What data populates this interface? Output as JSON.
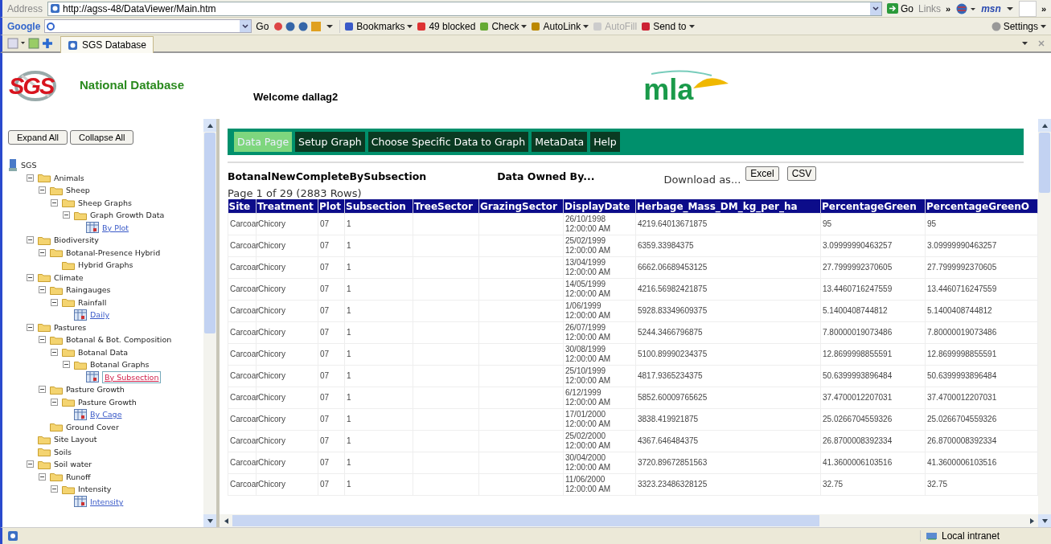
{
  "browser": {
    "address_label": "Address",
    "url": "http://agss-48/DataViewer/Main.htm",
    "go": "Go",
    "links": "Links",
    "links_more": "»",
    "msn": "msn",
    "more": "»",
    "google_label": "Google",
    "google_go": "Go",
    "toolbar_items": [
      {
        "label": "Bookmarks",
        "caret": true,
        "disabled": false
      },
      {
        "label": "49 blocked",
        "caret": false,
        "disabled": false
      },
      {
        "label": "Check",
        "caret": true,
        "disabled": false
      },
      {
        "label": "AutoLink",
        "caret": true,
        "disabled": false
      },
      {
        "label": "AutoFill",
        "caret": false,
        "disabled": true
      },
      {
        "label": "Send to",
        "caret": true,
        "disabled": false
      }
    ],
    "settings": "Settings",
    "tab": "SGS Database"
  },
  "header": {
    "logo": "SGS",
    "title": "National Database",
    "welcome": "Welcome dallag2",
    "partner_logo": "mla"
  },
  "sidebar": {
    "buttons": [
      "Expand All",
      "Collapse All"
    ],
    "tree": [
      {
        "label": "SGS",
        "kind": "root",
        "children": [
          {
            "label": "Animals",
            "kind": "folder",
            "expanded": true,
            "children": [
              {
                "label": "Sheep",
                "kind": "folder",
                "expanded": true,
                "children": [
                  {
                    "label": "Sheep Graphs",
                    "kind": "folder",
                    "expanded": true,
                    "children": [
                      {
                        "label": "Graph Growth Data",
                        "kind": "folder",
                        "expanded": true,
                        "children": [
                          {
                            "label": "By Plot",
                            "kind": "report",
                            "selected": false
                          }
                        ]
                      }
                    ]
                  }
                ]
              }
            ]
          },
          {
            "label": "Biodiversity",
            "kind": "folder",
            "expanded": true,
            "children": [
              {
                "label": "Botanal-Presence Hybrid",
                "kind": "folder",
                "expanded": true,
                "children": [
                  {
                    "label": "Hybrid Graphs",
                    "kind": "folder"
                  }
                ]
              }
            ]
          },
          {
            "label": "Climate",
            "kind": "folder",
            "expanded": true,
            "children": [
              {
                "label": "Raingauges",
                "kind": "folder",
                "expanded": true,
                "children": [
                  {
                    "label": "Rainfall",
                    "kind": "folder",
                    "expanded": true,
                    "children": [
                      {
                        "label": "Daily",
                        "kind": "report",
                        "selected": false
                      }
                    ]
                  }
                ]
              }
            ]
          },
          {
            "label": "Pastures",
            "kind": "folder",
            "expanded": true,
            "children": [
              {
                "label": "Botanal & Bot. Composition",
                "kind": "folder",
                "expanded": true,
                "children": [
                  {
                    "label": "Botanal Data",
                    "kind": "folder",
                    "expanded": true,
                    "children": [
                      {
                        "label": "Botanal Graphs",
                        "kind": "folder",
                        "expanded": true,
                        "children": [
                          {
                            "label": "By Subsection",
                            "kind": "report",
                            "selected": true
                          }
                        ]
                      }
                    ]
                  }
                ]
              },
              {
                "label": "Pasture Growth",
                "kind": "folder",
                "expanded": true,
                "children": [
                  {
                    "label": "Pasture Growth",
                    "kind": "folder",
                    "expanded": true,
                    "children": [
                      {
                        "label": "By Cage",
                        "kind": "report",
                        "selected": false
                      }
                    ]
                  }
                ]
              },
              {
                "label": "Ground Cover",
                "kind": "folder"
              }
            ]
          },
          {
            "label": "Site Layout",
            "kind": "folder"
          },
          {
            "label": "Soils",
            "kind": "folder"
          },
          {
            "label": "Soil water",
            "kind": "folder",
            "expanded": true,
            "children": [
              {
                "label": "Runoff",
                "kind": "folder",
                "expanded": true,
                "children": [
                  {
                    "label": "Intensity",
                    "kind": "folder",
                    "expanded": true,
                    "children": [
                      {
                        "label": "Intensity",
                        "kind": "report",
                        "selected": false
                      }
                    ]
                  }
                ]
              }
            ]
          }
        ]
      }
    ]
  },
  "menu": [
    {
      "label": "Data Page",
      "selected": true
    },
    {
      "label": "Setup Graph",
      "selected": false
    },
    {
      "label": "Choose Specific Data to Graph",
      "selected": false
    },
    {
      "label": "MetaData",
      "selected": false
    },
    {
      "label": "Help",
      "selected": false
    }
  ],
  "report": {
    "title": "BotanalNewCompleteBySubsection",
    "owner": "Data Owned By...",
    "download_label": "Download as...",
    "download_buttons": [
      "Excel",
      "CSV"
    ],
    "page_info": "Page 1 of 29 (2883 Rows)"
  },
  "table": {
    "columns": [
      "Site",
      "Treatment",
      "Plot",
      "Subsection",
      "TreeSector",
      "GrazingSector",
      "DisplayDate",
      "Herbage_Mass_DM_kg_per_ha",
      "PercentageGreen",
      "PercentageGreenO"
    ],
    "rows": [
      {
        "site": "Carcoar",
        "treatment": "Chicory",
        "plot": "07",
        "subsection": "1",
        "display_date": "26/10/1998 12:00:00 AM",
        "herbage_mass": "4219.64013671875",
        "percentage_green": "95",
        "column_10": "95"
      },
      {
        "site": "Carcoar",
        "treatment": "Chicory",
        "plot": "07",
        "subsection": "1",
        "display_date": "25/02/1999 12:00:00 AM",
        "herbage_mass": "6359.33984375",
        "percentage_green": "3.09999990463257",
        "column_10": "3.09999990463257"
      },
      {
        "site": "Carcoar",
        "treatment": "Chicory",
        "plot": "07",
        "subsection": "1",
        "display_date": "13/04/1999 12:00:00 AM",
        "herbage_mass": "6662.06689453125",
        "percentage_green": "27.7999992370605",
        "column_10": "27.7999992370605"
      },
      {
        "site": "Carcoar",
        "treatment": "Chicory",
        "plot": "07",
        "subsection": "1",
        "display_date": "14/05/1999 12:00:00 AM",
        "herbage_mass": "4216.56982421875",
        "percentage_green": "13.4460716247559",
        "column_10": "13.4460716247559"
      },
      {
        "site": "Carcoar",
        "treatment": "Chicory",
        "plot": "07",
        "subsection": "1",
        "display_date": "1/06/1999 12:00:00 AM",
        "herbage_mass": "5928.83349609375",
        "percentage_green": "5.1400408744812",
        "column_10": "5.1400408744812"
      },
      {
        "site": "Carcoar",
        "treatment": "Chicory",
        "plot": "07",
        "subsection": "1",
        "display_date": "26/07/1999 12:00:00 AM",
        "herbage_mass": "5244.3466796875",
        "percentage_green": "7.80000019073486",
        "column_10": "7.80000019073486"
      },
      {
        "site": "Carcoar",
        "treatment": "Chicory",
        "plot": "07",
        "subsection": "1",
        "display_date": "30/08/1999 12:00:00 AM",
        "herbage_mass": "5100.89990234375",
        "percentage_green": "12.8699998855591",
        "column_10": "12.8699998855591"
      },
      {
        "site": "Carcoar",
        "treatment": "Chicory",
        "plot": "07",
        "subsection": "1",
        "display_date": "25/10/1999 12:00:00 AM",
        "herbage_mass": "4817.9365234375",
        "percentage_green": "50.6399993896484",
        "column_10": "50.6399993896484"
      },
      {
        "site": "Carcoar",
        "treatment": "Chicory",
        "plot": "07",
        "subsection": "1",
        "display_date": "6/12/1999 12:00:00 AM",
        "herbage_mass": "5852.60009765625",
        "percentage_green": "37.4700012207031",
        "column_10": "37.4700012207031"
      },
      {
        "site": "Carcoar",
        "treatment": "Chicory",
        "plot": "07",
        "subsection": "1",
        "display_date": "17/01/2000 12:00:00 AM",
        "herbage_mass": "3838.419921875",
        "percentage_green": "25.0266704559326",
        "column_10": "25.0266704559326"
      },
      {
        "site": "Carcoar",
        "treatment": "Chicory",
        "plot": "07",
        "subsection": "1",
        "display_date": "25/02/2000 12:00:00 AM",
        "herbage_mass": "4367.646484375",
        "percentage_green": "26.8700008392334",
        "column_10": "26.8700008392334"
      },
      {
        "site": "Carcoar",
        "treatment": "Chicory",
        "plot": "07",
        "subsection": "1",
        "display_date": "30/04/2000 12:00:00 AM",
        "herbage_mass": "3720.89672851563",
        "percentage_green": "41.3600006103516",
        "column_10": "41.3600006103516"
      },
      {
        "site": "Carcoar",
        "treatment": "Chicory",
        "plot": "07",
        "subsection": "1",
        "display_date": "11/06/2000 12:00:00 AM",
        "herbage_mass": "3323.23486328125",
        "percentage_green": "32.75",
        "column_10": "32.75"
      }
    ]
  },
  "status_bar": {
    "zone": "Local intranet"
  }
}
